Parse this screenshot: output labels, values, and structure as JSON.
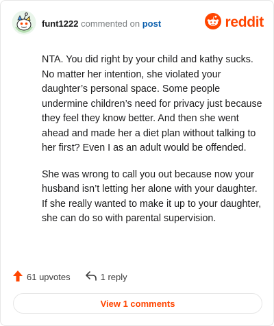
{
  "comment": {
    "username": "funt1222",
    "action_text": "commented on",
    "post_link": "post",
    "brand": "reddit",
    "paragraphs": [
      "NTA. You did right by your child and kathy sucks. No matter her intention, she violated your daughter’s personal space. Some people undermine children’s need for privacy just because they feel they know better. And then she went ahead and made her a diet plan without talking to her first? Even I as an adult would be offended.",
      "She was wrong to call you out because now your husband isn’t letting her alone with your daughter. If she really wanted to make it up to your daughter, she can do so with parental supervision."
    ],
    "upvotes": "61 upvotes",
    "replies": "1 reply",
    "view_comments": "View 1 comments"
  },
  "colors": {
    "brand": "#ff4500",
    "link": "#0b5fad",
    "muted": "#787c7e"
  },
  "icons": {
    "avatar": "snoo-avatar-icon",
    "brand": "reddit-logo-icon",
    "upvote": "upvote-arrow-icon",
    "reply": "reply-arrow-icon"
  }
}
